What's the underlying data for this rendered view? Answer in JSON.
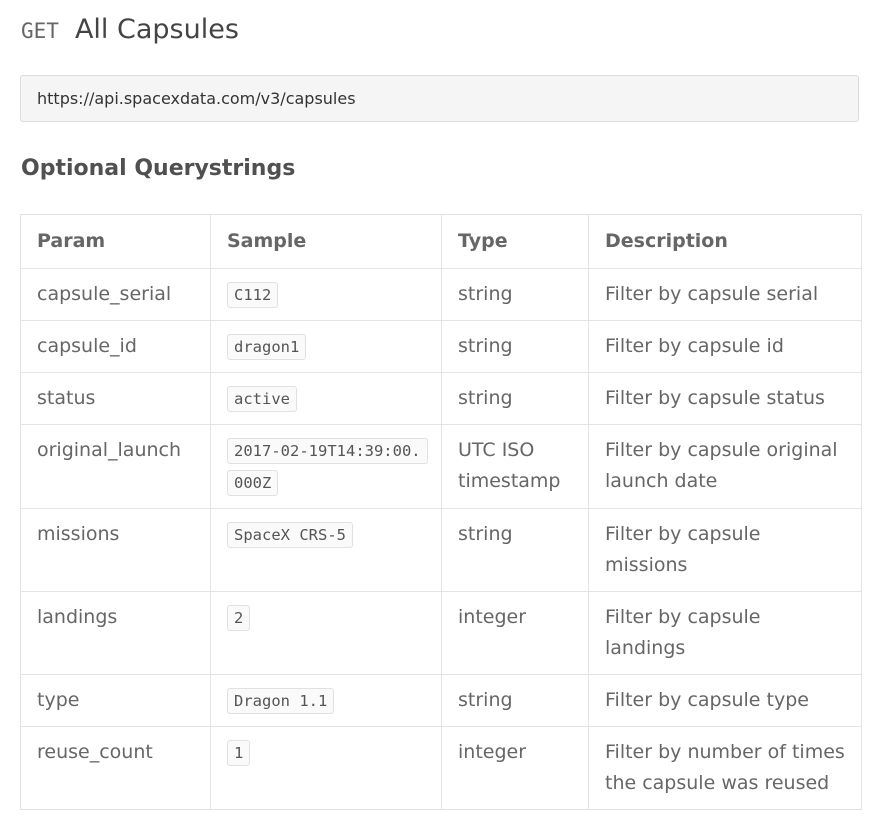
{
  "header": {
    "method": "GET",
    "title": "All Capsules"
  },
  "endpoint": {
    "url": "https://api.spacexdata.com/v3/capsules"
  },
  "querystrings": {
    "heading": "Optional Querystrings",
    "columns": [
      "Param",
      "Sample",
      "Type",
      "Description"
    ],
    "rows": [
      {
        "param": "capsule_serial",
        "sample": "C112",
        "type": "string",
        "description": "Filter by capsule serial"
      },
      {
        "param": "capsule_id",
        "sample": "dragon1",
        "type": "string",
        "description": "Filter by capsule id"
      },
      {
        "param": "status",
        "sample": "active",
        "type": "string",
        "description": "Filter by capsule status"
      },
      {
        "param": "original_launch",
        "sample": "2017-02-19T14:39:00.000Z",
        "type": "UTC ISO timestamp",
        "description": "Filter by capsule original launch date"
      },
      {
        "param": "missions",
        "sample": "SpaceX CRS-5",
        "type": "string",
        "description": "Filter by capsule missions"
      },
      {
        "param": "landings",
        "sample": "2",
        "type": "integer",
        "description": "Filter by capsule landings"
      },
      {
        "param": "type",
        "sample": "Dragon 1.1",
        "type": "string",
        "description": "Filter by capsule type"
      },
      {
        "param": "reuse_count",
        "sample": "1",
        "type": "integer",
        "description": "Filter by number of times the capsule was reused"
      }
    ]
  }
}
